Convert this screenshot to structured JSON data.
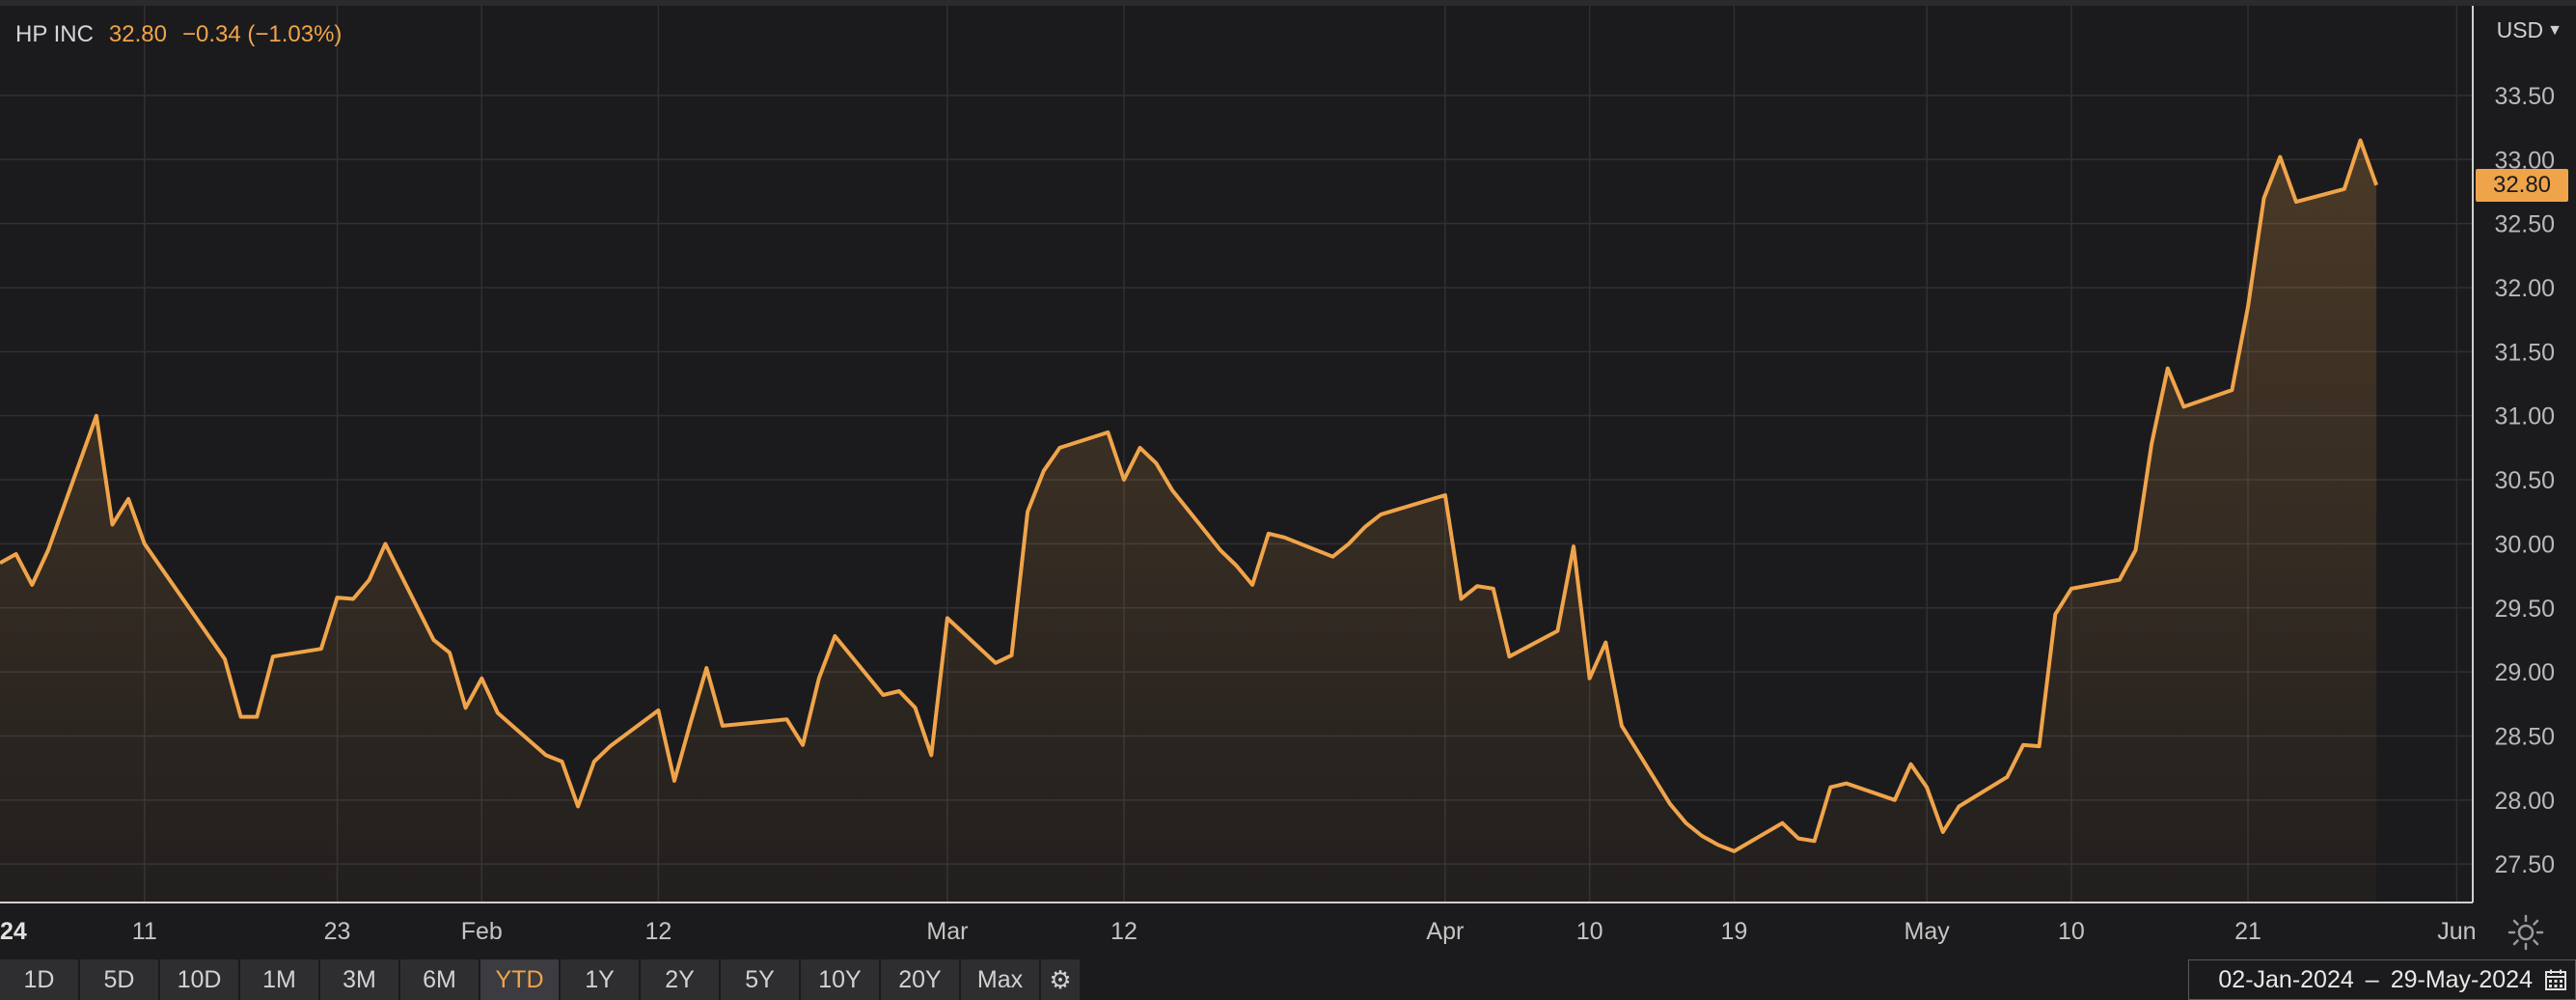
{
  "header": {
    "name": "HP INC",
    "price": "32.80",
    "change": "−0.34 (−1.03%)"
  },
  "currency": {
    "label": "USD"
  },
  "price_tag": {
    "label": "32.80"
  },
  "range_buttons": [
    "1D",
    "5D",
    "10D",
    "1M",
    "3M",
    "6M",
    "YTD",
    "1Y",
    "2Y",
    "5Y",
    "10Y",
    "20Y",
    "Max"
  ],
  "active_range": "YTD",
  "date_range": {
    "start": "02-Jan-2024",
    "separator": "–",
    "end": "29-May-2024"
  },
  "colors": {
    "line": "#f0a44a",
    "background": "#1b1b1d",
    "grid": "#303034"
  },
  "icons": {
    "settings": "gear-icon",
    "currency_dropdown": "chevron-down-icon",
    "calendar": "calendar-icon",
    "theme": "sun-icon"
  },
  "chart_data": {
    "type": "area",
    "grid": true,
    "ylim": [
      27.2,
      34.2
    ],
    "y_ticks": [
      27.5,
      28.0,
      28.5,
      29.0,
      29.5,
      30.0,
      30.5,
      31.0,
      31.5,
      32.0,
      32.5,
      33.0,
      33.5
    ],
    "y_tick_labels": [
      "27.50",
      "28.00",
      "28.50",
      "29.00",
      "29.50",
      "30.00",
      "30.50",
      "31.00",
      "31.50",
      "32.00",
      "32.50",
      "33.00",
      "33.50"
    ],
    "x_domain": [
      "2024-01-02",
      "2024-06-04"
    ],
    "x_ticks": [
      {
        "date": "2024-01-02",
        "label": "24",
        "bold": true
      },
      {
        "date": "2024-01-11",
        "label": "11"
      },
      {
        "date": "2024-01-23",
        "label": "23"
      },
      {
        "date": "2024-02-01",
        "label": "Feb"
      },
      {
        "date": "2024-02-12",
        "label": "12"
      },
      {
        "date": "2024-03-01",
        "label": "Mar"
      },
      {
        "date": "2024-03-12",
        "label": "12"
      },
      {
        "date": "2024-04-01",
        "label": "Apr"
      },
      {
        "date": "2024-04-10",
        "label": "10"
      },
      {
        "date": "2024-04-19",
        "label": "19"
      },
      {
        "date": "2024-05-01",
        "label": "May"
      },
      {
        "date": "2024-05-10",
        "label": "10"
      },
      {
        "date": "2024-05-21",
        "label": "21"
      },
      {
        "date": "2024-06-03",
        "label": "Jun"
      }
    ],
    "series": [
      {
        "points": [
          [
            "2024-01-02",
            29.85
          ],
          [
            "2024-01-03",
            29.92
          ],
          [
            "2024-01-04",
            29.68
          ],
          [
            "2024-01-05",
            29.95
          ],
          [
            "2024-01-08",
            31.0
          ],
          [
            "2024-01-09",
            30.15
          ],
          [
            "2024-01-10",
            30.35
          ],
          [
            "2024-01-11",
            30.0
          ],
          [
            "2024-01-12",
            29.82
          ],
          [
            "2024-01-16",
            29.1
          ],
          [
            "2024-01-17",
            28.65
          ],
          [
            "2024-01-18",
            28.65
          ],
          [
            "2024-01-19",
            29.12
          ],
          [
            "2024-01-22",
            29.18
          ],
          [
            "2024-01-23",
            29.58
          ],
          [
            "2024-01-24",
            29.57
          ],
          [
            "2024-01-25",
            29.72
          ],
          [
            "2024-01-26",
            30.0
          ],
          [
            "2024-01-29",
            29.25
          ],
          [
            "2024-01-30",
            29.15
          ],
          [
            "2024-01-31",
            28.72
          ],
          [
            "2024-02-01",
            28.95
          ],
          [
            "2024-02-02",
            28.68
          ],
          [
            "2024-02-05",
            28.35
          ],
          [
            "2024-02-06",
            28.3
          ],
          [
            "2024-02-07",
            27.95
          ],
          [
            "2024-02-08",
            28.3
          ],
          [
            "2024-02-09",
            28.42
          ],
          [
            "2024-02-12",
            28.7
          ],
          [
            "2024-02-13",
            28.15
          ],
          [
            "2024-02-14",
            28.6
          ],
          [
            "2024-02-15",
            29.03
          ],
          [
            "2024-02-16",
            28.58
          ],
          [
            "2024-02-20",
            28.63
          ],
          [
            "2024-02-21",
            28.43
          ],
          [
            "2024-02-22",
            28.95
          ],
          [
            "2024-02-23",
            29.28
          ],
          [
            "2024-02-26",
            28.82
          ],
          [
            "2024-02-27",
            28.85
          ],
          [
            "2024-02-28",
            28.72
          ],
          [
            "2024-02-29",
            28.35
          ],
          [
            "2024-03-01",
            29.42
          ],
          [
            "2024-03-04",
            29.07
          ],
          [
            "2024-03-05",
            29.13
          ],
          [
            "2024-03-06",
            30.25
          ],
          [
            "2024-03-07",
            30.57
          ],
          [
            "2024-03-08",
            30.75
          ],
          [
            "2024-03-11",
            30.87
          ],
          [
            "2024-03-12",
            30.5
          ],
          [
            "2024-03-13",
            30.75
          ],
          [
            "2024-03-14",
            30.63
          ],
          [
            "2024-03-15",
            30.42
          ],
          [
            "2024-03-18",
            29.95
          ],
          [
            "2024-03-19",
            29.83
          ],
          [
            "2024-03-20",
            29.68
          ],
          [
            "2024-03-21",
            30.08
          ],
          [
            "2024-03-22",
            30.05
          ],
          [
            "2024-03-25",
            29.9
          ],
          [
            "2024-03-26",
            30.0
          ],
          [
            "2024-03-27",
            30.13
          ],
          [
            "2024-03-28",
            30.23
          ],
          [
            "2024-04-01",
            30.38
          ],
          [
            "2024-04-02",
            29.57
          ],
          [
            "2024-04-03",
            29.67
          ],
          [
            "2024-04-04",
            29.65
          ],
          [
            "2024-04-05",
            29.12
          ],
          [
            "2024-04-08",
            29.32
          ],
          [
            "2024-04-09",
            29.98
          ],
          [
            "2024-04-10",
            28.95
          ],
          [
            "2024-04-11",
            29.23
          ],
          [
            "2024-04-12",
            28.58
          ],
          [
            "2024-04-15",
            27.97
          ],
          [
            "2024-04-16",
            27.82
          ],
          [
            "2024-04-17",
            27.72
          ],
          [
            "2024-04-18",
            27.65
          ],
          [
            "2024-04-19",
            27.6
          ],
          [
            "2024-04-22",
            27.82
          ],
          [
            "2024-04-23",
            27.7
          ],
          [
            "2024-04-24",
            27.68
          ],
          [
            "2024-04-25",
            28.1
          ],
          [
            "2024-04-26",
            28.13
          ],
          [
            "2024-04-29",
            28.0
          ],
          [
            "2024-04-30",
            28.28
          ],
          [
            "2024-05-01",
            28.1
          ],
          [
            "2024-05-02",
            27.75
          ],
          [
            "2024-05-03",
            27.95
          ],
          [
            "2024-05-06",
            28.18
          ],
          [
            "2024-05-07",
            28.43
          ],
          [
            "2024-05-08",
            28.42
          ],
          [
            "2024-05-09",
            29.45
          ],
          [
            "2024-05-10",
            29.65
          ],
          [
            "2024-05-13",
            29.72
          ],
          [
            "2024-05-14",
            29.95
          ],
          [
            "2024-05-15",
            30.78
          ],
          [
            "2024-05-16",
            31.37
          ],
          [
            "2024-05-17",
            31.07
          ],
          [
            "2024-05-20",
            31.2
          ],
          [
            "2024-05-21",
            31.85
          ],
          [
            "2024-05-22",
            32.7
          ],
          [
            "2024-05-23",
            33.02
          ],
          [
            "2024-05-24",
            32.67
          ],
          [
            "2024-05-27",
            32.77
          ],
          [
            "2024-05-28",
            33.15
          ],
          [
            "2024-05-29",
            32.8
          ]
        ]
      }
    ]
  }
}
